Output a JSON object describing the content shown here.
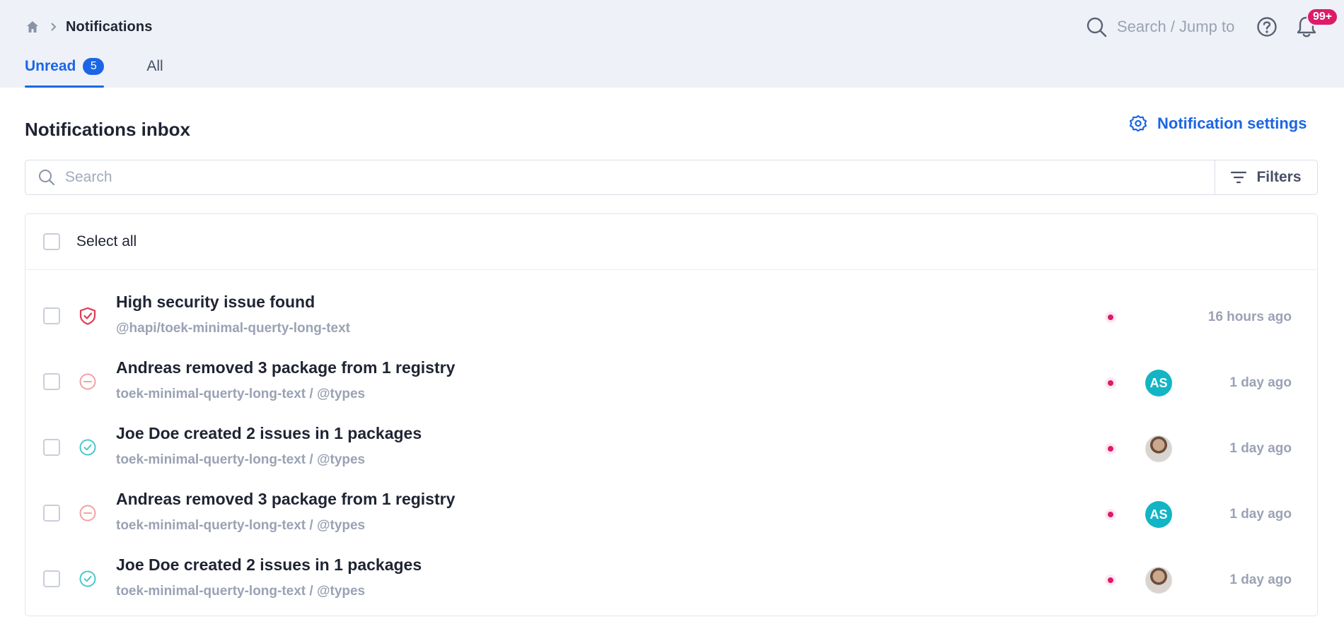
{
  "header": {
    "breadcrumb_current": "Notifications",
    "search_label": "Search / Jump to",
    "bell_badge": "99+"
  },
  "tabs": [
    {
      "label": "Unread",
      "count": "5",
      "active": true
    },
    {
      "label": "All",
      "active": false
    }
  ],
  "main": {
    "title": "Notifications inbox",
    "settings_label": "Notification settings",
    "search_placeholder": "Search",
    "filters_label": "Filters",
    "select_all_label": "Select all"
  },
  "notifications": [
    {
      "title": "High security issue found",
      "sub": "@hapi/toek-minimal-querty-long-text",
      "time": "16 hours ago",
      "icon": "shield-check-icon",
      "avatar": ""
    },
    {
      "title": "Andreas removed 3 package from 1 registry",
      "sub": "toek-minimal-querty-long-text / @types",
      "time": "1 day ago",
      "icon": "minus-circle-icon",
      "avatar": "AS"
    },
    {
      "title": "Joe Doe created 2 issues in 1 packages",
      "sub": "toek-minimal-querty-long-text / @types",
      "time": "1 day ago",
      "icon": "check-circle-icon",
      "avatar": "photo"
    },
    {
      "title": "Andreas removed 3 package from 1 registry",
      "sub": "toek-minimal-querty-long-text / @types",
      "time": "1 day ago",
      "icon": "minus-circle-icon",
      "avatar": "AS"
    },
    {
      "title": "Joe Doe created 2 issues in 1 packages",
      "sub": "toek-minimal-querty-long-text / @types",
      "time": "1 day ago",
      "icon": "check-circle-icon",
      "avatar": "photo"
    }
  ],
  "colors": {
    "accent": "#1b66e6",
    "danger": "#dd1b6a",
    "teal": "#13b5c4"
  }
}
